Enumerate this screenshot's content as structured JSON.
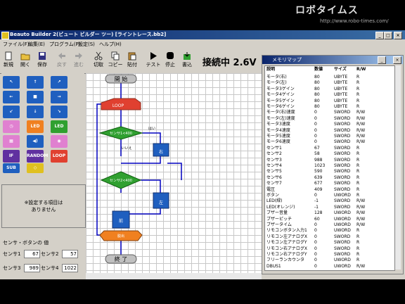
{
  "app": {
    "title": "Beauto Builder 2(ビュート ビルダー ツー) [ライントレース.bb2]",
    "status": "接続中 2.6V"
  },
  "banner": {
    "logo": "ロボタイムス",
    "url": "http://www.robo-times.com/"
  },
  "menu": [
    "ファイル(F)",
    "編集(E)",
    "プログラム(P)",
    "設定(S)",
    "ヘルプ(H)"
  ],
  "toolbar": [
    {
      "label": "新規",
      "icon": "new-file-icon",
      "enabled": true
    },
    {
      "label": "開く",
      "icon": "open-folder-icon",
      "enabled": true
    },
    {
      "label": "保存",
      "icon": "save-icon",
      "enabled": true
    },
    {
      "label": "戻す",
      "icon": "undo-arrow-icon",
      "enabled": false
    },
    {
      "label": "進む",
      "icon": "redo-arrow-icon",
      "enabled": false
    },
    {
      "label": "切取",
      "icon": "cut-icon",
      "enabled": true
    },
    {
      "label": "コピー",
      "icon": "copy-icon",
      "enabled": true
    },
    {
      "label": "貼付",
      "icon": "paste-icon",
      "enabled": true
    },
    {
      "label": "テスト",
      "icon": "test-run-icon",
      "enabled": true
    },
    {
      "label": "停止",
      "icon": "stop-icon",
      "enabled": true
    },
    {
      "label": "書込",
      "icon": "write-icon",
      "enabled": true
    }
  ],
  "palette": {
    "labels": [
      "LED",
      "LED",
      "RANDOM",
      "LOOP",
      "LOOP",
      "SUB",
      "IF"
    ],
    "colors": {
      "blue": "#1f5fbf",
      "pink": "#e080d0",
      "orange": "#f08020",
      "green": "#30a030",
      "purple": "#6030a0",
      "red": "#e04030",
      "yellow": "#e0c020"
    }
  },
  "settings_message": "※設定する項目は\nありません",
  "sensor_panel": {
    "title": "センサ・ボタンの 値",
    "sensors": [
      {
        "label": "センサ1",
        "value": "67"
      },
      {
        "label": "センサ2",
        "value": "57"
      },
      {
        "label": "センサ3",
        "value": "989"
      },
      {
        "label": "センサ4",
        "value": "1022"
      }
    ]
  },
  "flow": {
    "start": "開 始",
    "end": "終 了",
    "loop": "LOOP",
    "loop_end": "脱出",
    "if1": "センサ1<400",
    "if2": "センサ2<400",
    "yes": "はい",
    "no": "いいえ",
    "motor_l": "左",
    "motor_r": "右",
    "motor_f": "前"
  },
  "memory_map": {
    "title": "メモリマップ",
    "headers": [
      "説明",
      "数値",
      "サイズ",
      "R/W"
    ],
    "rows": [
      [
        "モータ(右)",
        "80",
        "UBYTE",
        "R"
      ],
      [
        "モータ(左)",
        "80",
        "UBYTE",
        "R"
      ],
      [
        "モータ3ゲイン",
        "80",
        "UBYTE",
        "R"
      ],
      [
        "モータ4ゲイン",
        "80",
        "UBYTE",
        "R"
      ],
      [
        "モータ5ゲイン",
        "80",
        "UBYTE",
        "R"
      ],
      [
        "モータ6ゲイン",
        "80",
        "UBYTE",
        "R"
      ],
      [
        "モータ(右)速度",
        "0",
        "SWORD",
        "R/W"
      ],
      [
        "モータ(左)速度",
        "0",
        "SWORD",
        "R/W"
      ],
      [
        "モータ3速度",
        "0",
        "SWORD",
        "R/W"
      ],
      [
        "モータ4速度",
        "0",
        "SWORD",
        "R/W"
      ],
      [
        "モータ5速度",
        "0",
        "SWORD",
        "R/W"
      ],
      [
        "モータ6速度",
        "0",
        "SWORD",
        "R/W"
      ],
      [
        "センサ1",
        "67",
        "SWORD",
        "R"
      ],
      [
        "センサ2",
        "58",
        "SWORD",
        "R"
      ],
      [
        "センサ3",
        "988",
        "SWORD",
        "R"
      ],
      [
        "センサ4",
        "1023",
        "SWORD",
        "R"
      ],
      [
        "センサ5",
        "590",
        "SWORD",
        "R"
      ],
      [
        "センサ6",
        "639",
        "SWORD",
        "R"
      ],
      [
        "センサ7",
        "677",
        "SWORD",
        "R"
      ],
      [
        "電圧",
        "409",
        "SWORD",
        "R"
      ],
      [
        "ボタン",
        "0",
        "UWORD",
        "R"
      ],
      [
        "LED(緑)",
        "-1",
        "SWORD",
        "R/W"
      ],
      [
        "LED(オレンジ)",
        "-1",
        "SWORD",
        "R/W"
      ],
      [
        "ブザー音量",
        "128",
        "UWORD",
        "R/W"
      ],
      [
        "ブザーピッチ",
        "60",
        "UWORD",
        "R/W"
      ],
      [
        "ブザータイム",
        "0",
        "UWORD",
        "R/W"
      ],
      [
        "リモコンボタン入力1",
        "0",
        "UWORD",
        "R"
      ],
      [
        "リモコン左アナログX",
        "0",
        "SWORD",
        "R"
      ],
      [
        "リモコン左アナログY",
        "0",
        "SWORD",
        "R"
      ],
      [
        "リモコン右アナログX",
        "0",
        "SWORD",
        "R"
      ],
      [
        "リモコン右アナログY",
        "0",
        "SWORD",
        "R"
      ],
      [
        "フリーランカウンタ",
        "0",
        "UWORD",
        "R"
      ],
      [
        "DBUS1",
        "0",
        "UWORD",
        "R/W"
      ]
    ]
  }
}
